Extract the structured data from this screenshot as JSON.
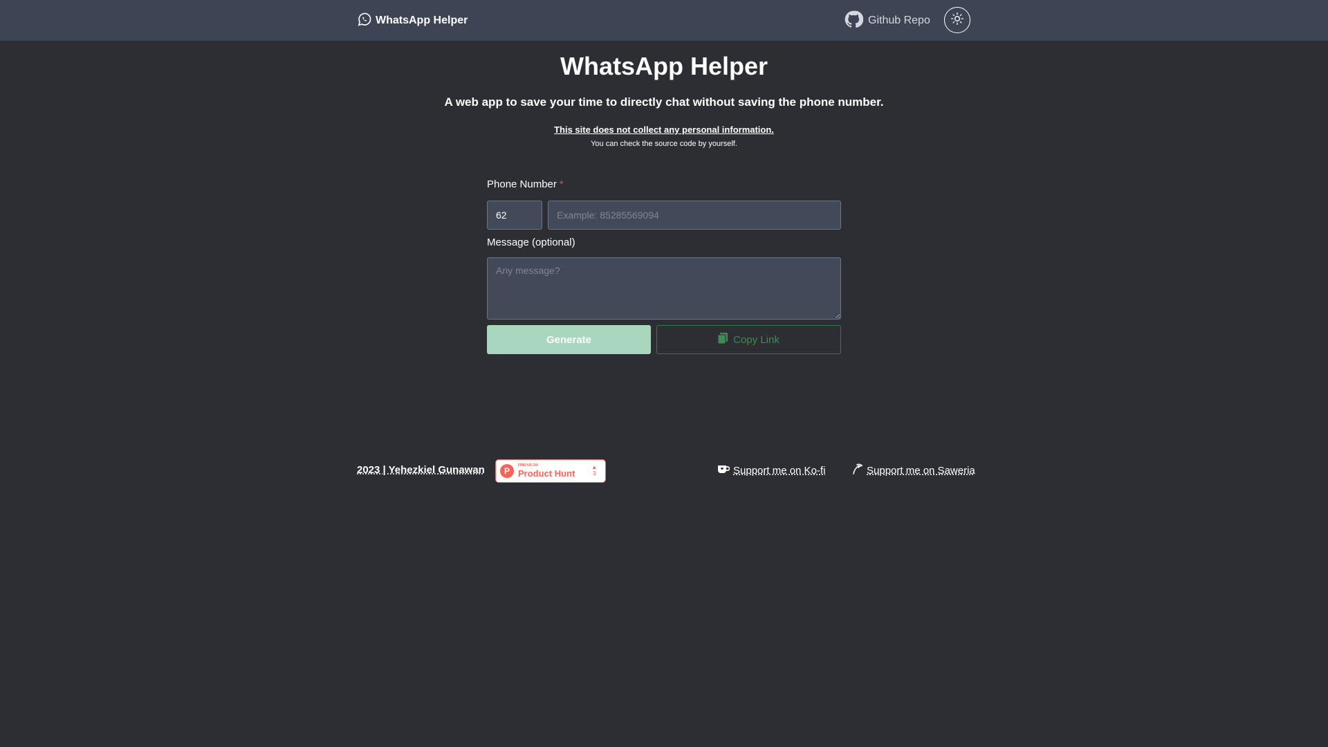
{
  "navbar": {
    "brand": "WhatsApp Helper",
    "github_label": "Github Repo"
  },
  "main": {
    "title": "WhatsApp Helper",
    "subtitle": "A web app to save your time to directly chat without saving the phone number.",
    "privacy": "This site does not collect any personal information.",
    "privacy_note": "You can check the source code by yourself."
  },
  "form": {
    "phone_label": "Phone Number",
    "required_mark": "*",
    "country_code_value": "62",
    "phone_placeholder": "Example: 85285569094",
    "message_label": "Message (optional)",
    "message_placeholder": "Any message?",
    "generate_label": "Generate",
    "copy_label": "Copy Link"
  },
  "footer": {
    "copyright": "2023 | Yehezkiel Gunawan",
    "product_hunt_small": "FIND US ON",
    "product_hunt_big": "Product Hunt",
    "product_hunt_votes": "3",
    "kofi_label": "Support me on Ko-fi",
    "saweria_label": "Support me on Saweria"
  },
  "colors": {
    "background": "#2d2e33",
    "navbar": "#3d4554",
    "generate_button": "#a8d7bd",
    "copy_border": "#2f7d4a",
    "required": "#e5484d",
    "product_hunt": "#ff6154"
  },
  "icons": [
    "whatsapp-icon",
    "github-icon",
    "sun-icon",
    "clipboard-icon",
    "kofi-cup-icon",
    "saweria-icon",
    "product-hunt-logo-icon",
    "upvote-arrow-icon"
  ]
}
